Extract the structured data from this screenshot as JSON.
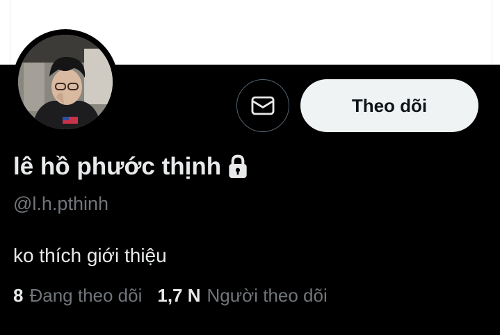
{
  "profile": {
    "display_name": "lê hồ phước thịnh",
    "handle": "@l.h.pthinh",
    "bio": "ko thích giới thiệu",
    "locked_icon": "lock-icon",
    "avatar_icon": "profile-photo"
  },
  "actions": {
    "message_icon": "envelope-icon",
    "follow_label": "Theo dõi"
  },
  "stats": {
    "following_count": "8",
    "following_label": "Đang theo dõi",
    "followers_count": "1,7 N",
    "followers_label": "Người theo dõi"
  },
  "colors": {
    "background": "#000000",
    "banner": "#ffffff",
    "primary_text": "#e7e9ea",
    "secondary_text": "#71767b",
    "follow_button_bg": "#eff3f4",
    "follow_button_text": "#0f1419"
  }
}
